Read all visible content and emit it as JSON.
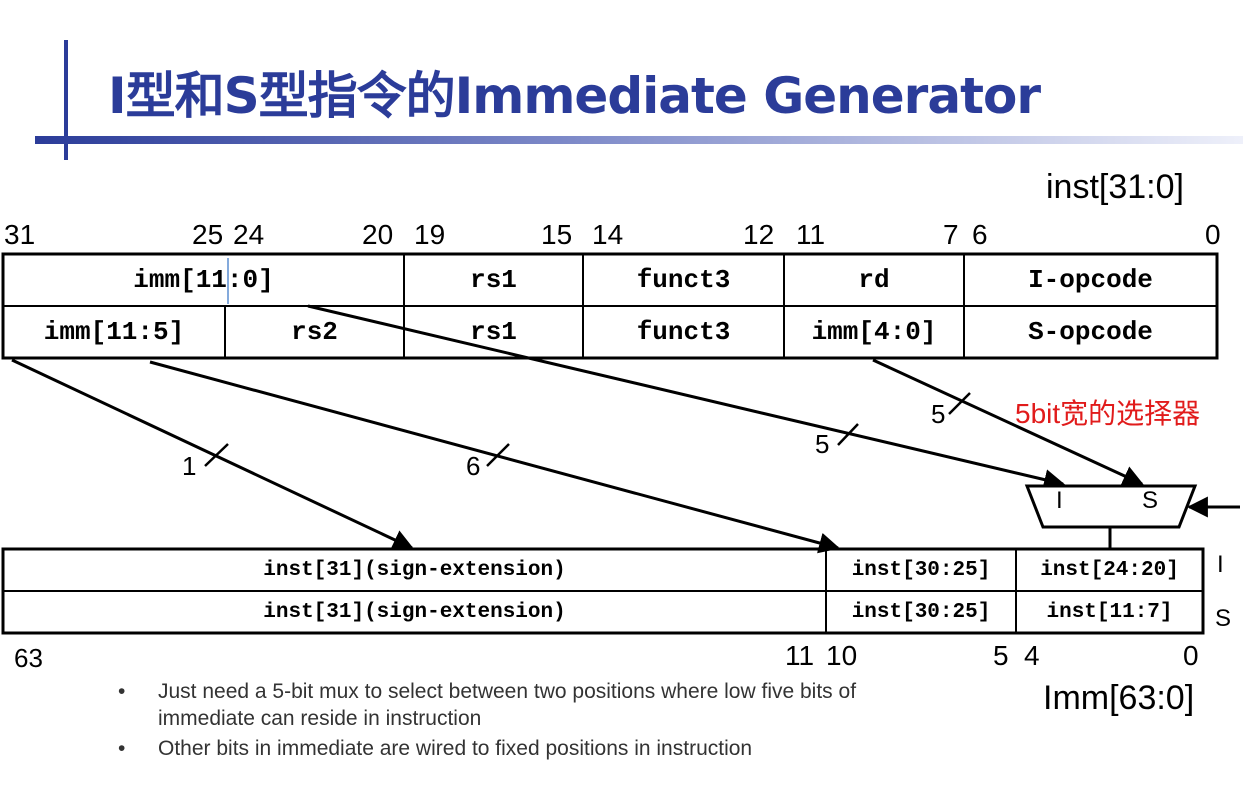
{
  "title": "I型和S型指令的Immediate Generator",
  "inst_label": "inst[31:0]",
  "imm_label": "Imm[63:0]",
  "top_bit_numbers": [
    "31",
    "25",
    "24",
    "20",
    "19",
    "15",
    "14",
    "12",
    "11",
    "7",
    "6",
    "0"
  ],
  "i_format": {
    "imm": "imm[11:0]",
    "rs1": "rs1",
    "funct3": "funct3",
    "rd": "rd",
    "opcode": "I-opcode"
  },
  "s_format": {
    "imm_hi": "imm[11:5]",
    "rs2": "rs2",
    "rs1": "rs1",
    "funct3": "funct3",
    "imm_lo": "imm[4:0]",
    "opcode": "S-opcode"
  },
  "imm_rows": {
    "i": {
      "sign": "inst[31](sign-extension)",
      "mid": "inst[30:25]",
      "low": "inst[24:20]",
      "tag": "I"
    },
    "s": {
      "sign": "inst[31](sign-extension)",
      "mid": "inst[30:25]",
      "low": "inst[11:7]",
      "tag": "S"
    }
  },
  "bottom_bit_numbers": [
    "63",
    "11",
    "10",
    "5",
    "4",
    "0"
  ],
  "wire_widths": {
    "sign": "1",
    "mid": "6",
    "i_low": "5",
    "s_low": "5"
  },
  "mux": {
    "left_input": "I",
    "right_input": "S",
    "caption": "5bit宽的选择器"
  },
  "bullets": [
    "Just need a 5-bit mux to select between two positions where low five bits of immediate can reside in instruction",
    "Other bits in immediate are wired to fixed positions in instruction"
  ],
  "colors": {
    "title": "#2b3c99",
    "caption": "#e11b1b",
    "bullet_text": "#333333"
  }
}
